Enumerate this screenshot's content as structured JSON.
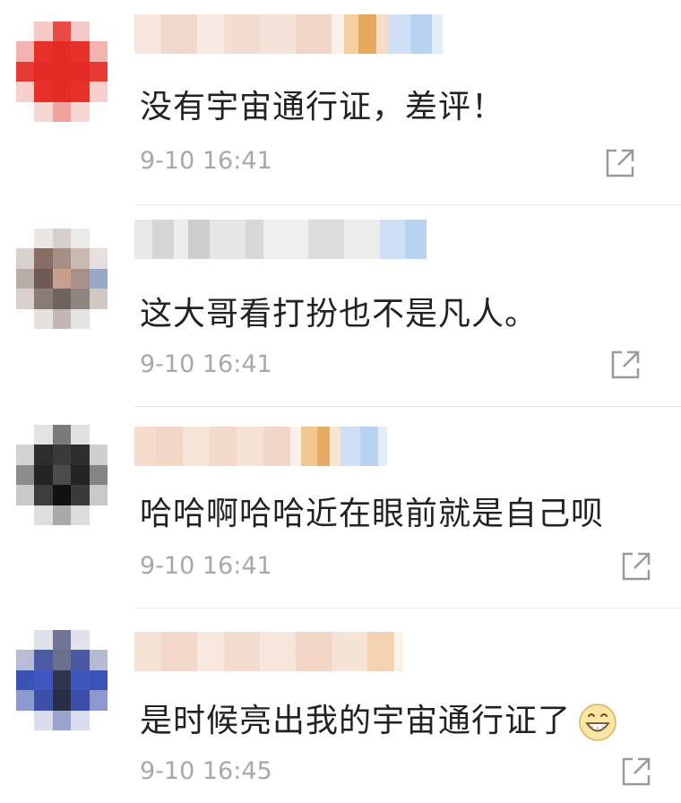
{
  "comments": [
    {
      "text": "没有宇宙通行证，差评！",
      "time": "9-10 16:41",
      "emoji": ""
    },
    {
      "text": "这大哥看打扮也不是凡人。",
      "time": "9-10 16:41",
      "emoji": ""
    },
    {
      "text": "哈哈啊哈哈近在眼前就是自己呗",
      "time": "9-10 16:41",
      "emoji": ""
    },
    {
      "text": "是时候亮出我的宇宙通行证了",
      "time": "9-10 16:45",
      "emoji": "grinning-face-emoji"
    }
  ],
  "icons": {
    "share": "share-icon"
  },
  "colors": {
    "text": "#222222",
    "time": "#a8a8a8",
    "divider": "#e8e8e8"
  }
}
